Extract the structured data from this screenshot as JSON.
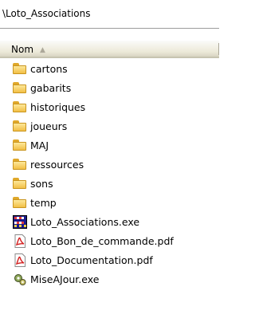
{
  "path": "\\Loto_Associations",
  "columns": {
    "name": "Nom",
    "sort_indicator": "▲"
  },
  "items": [
    {
      "label": "cartons",
      "type": "folder"
    },
    {
      "label": "gabarits",
      "type": "folder"
    },
    {
      "label": "historiques",
      "type": "folder"
    },
    {
      "label": "joueurs",
      "type": "folder"
    },
    {
      "label": "MAJ",
      "type": "folder"
    },
    {
      "label": "ressources",
      "type": "folder"
    },
    {
      "label": "sons",
      "type": "folder"
    },
    {
      "label": "temp",
      "type": "folder"
    },
    {
      "label": "Loto_Associations.exe",
      "type": "exe-grid"
    },
    {
      "label": "Loto_Bon_de_commande.pdf",
      "type": "pdf"
    },
    {
      "label": "Loto_Documentation.pdf",
      "type": "pdf"
    },
    {
      "label": "MiseAJour.exe",
      "type": "exe-gear"
    }
  ]
}
